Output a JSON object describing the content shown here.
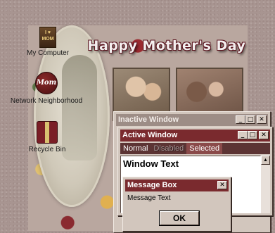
{
  "wallpaper": {
    "title": "Happy Mother's Day"
  },
  "desktop_icons": [
    {
      "label": "My Computer",
      "icon": "mom-book-icon",
      "glyph_text": "I ♥ MOM"
    },
    {
      "label": "Network Neighborhood",
      "icon": "mom-badge-icon",
      "glyph_text": "Mom"
    },
    {
      "label": "Recycle Bin",
      "icon": "gift-box-icon"
    }
  ],
  "inactive_window": {
    "title": "Inactive Window"
  },
  "active_window": {
    "title": "Active Window",
    "menu": {
      "normal": "Normal",
      "disabled": "Disabled",
      "selected": "Selected"
    },
    "window_text": "Window Text"
  },
  "message_box": {
    "title": "Message Box",
    "text": "Message Text",
    "ok_label": "OK"
  },
  "title_buttons": {
    "minimize": "_",
    "maximize": "□",
    "close": "✕",
    "scroll_up": "▲"
  },
  "colors": {
    "active_title": "#7a2a2e",
    "inactive_title": "#9d8d86",
    "menu_bar": "#5c3434",
    "window_face": "#d2c6bd",
    "desktop": "#a89591"
  }
}
